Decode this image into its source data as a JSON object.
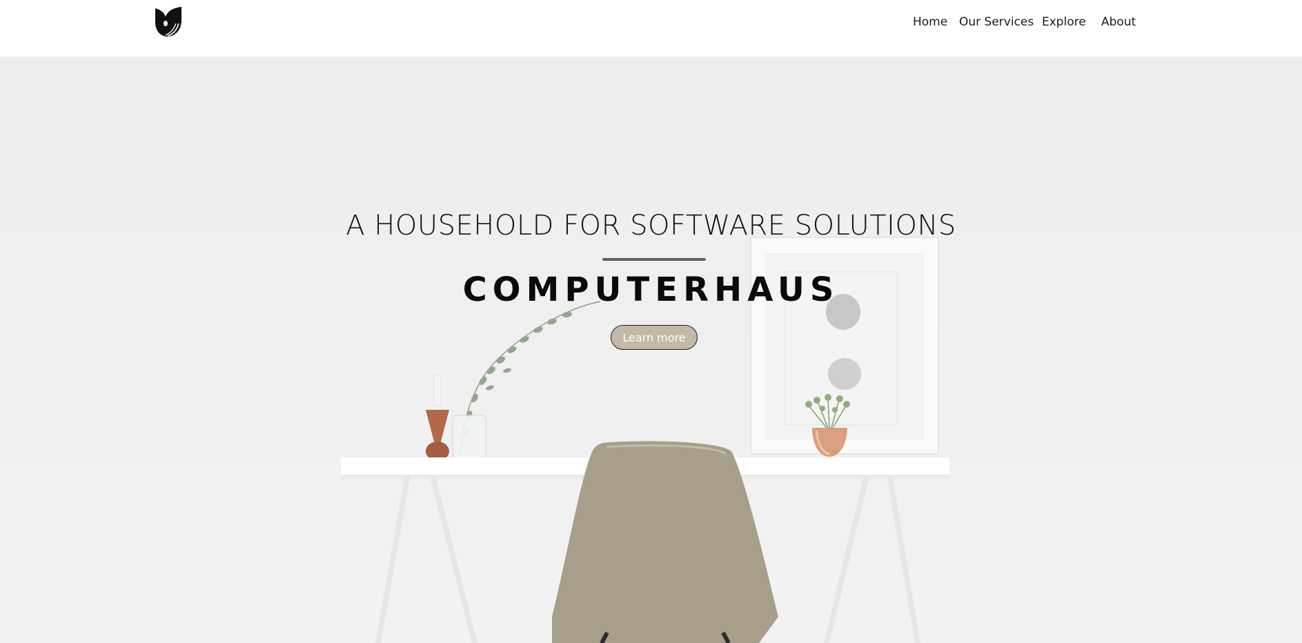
{
  "header": {
    "logo_icon": "tulip-logo-icon",
    "nav": {
      "home": "Home",
      "services": "Our Services",
      "explore": "Explore",
      "about": "About"
    }
  },
  "hero": {
    "tagline": "A HOUSEHOLD FOR SOFTWARE SOLUTIONS",
    "title": "COMPUTERHAUS",
    "cta_label": "Learn more",
    "background_image": "white-desk-chair-plant-photo"
  },
  "colors": {
    "button_fill": "#c4b8a6",
    "divider": "#5f5f5f",
    "chair": "#a89f8a"
  }
}
